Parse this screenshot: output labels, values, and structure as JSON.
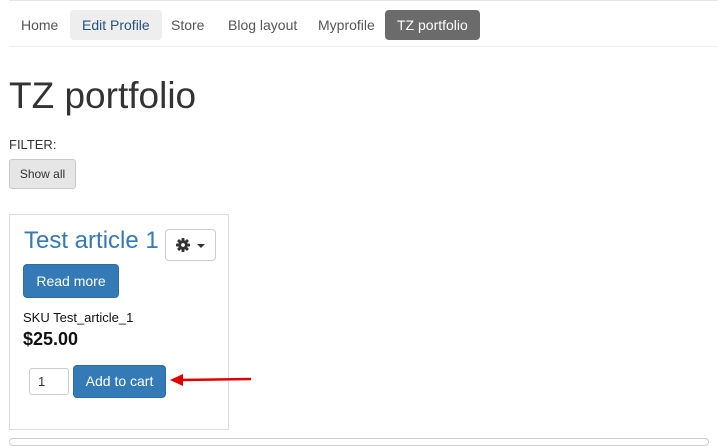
{
  "nav": {
    "items": [
      {
        "label": "Home"
      },
      {
        "label": "Edit Profile"
      },
      {
        "label": "Store"
      },
      {
        "label": "Blog layout"
      },
      {
        "label": "Myprofile"
      },
      {
        "label": "TZ portfolio"
      }
    ]
  },
  "page": {
    "title": "TZ portfolio"
  },
  "filter": {
    "label": "FILTER:",
    "show_all": "Show all"
  },
  "article": {
    "title": "Test article 1",
    "read_more": "Read more",
    "sku": "SKU Test_article_1",
    "price": "$25.00",
    "quantity": "1",
    "add_to_cart": "Add to cart"
  },
  "colors": {
    "accent": "#337ab7",
    "active_nav": "#6b6b6b",
    "annotation_arrow": "#e00000"
  }
}
